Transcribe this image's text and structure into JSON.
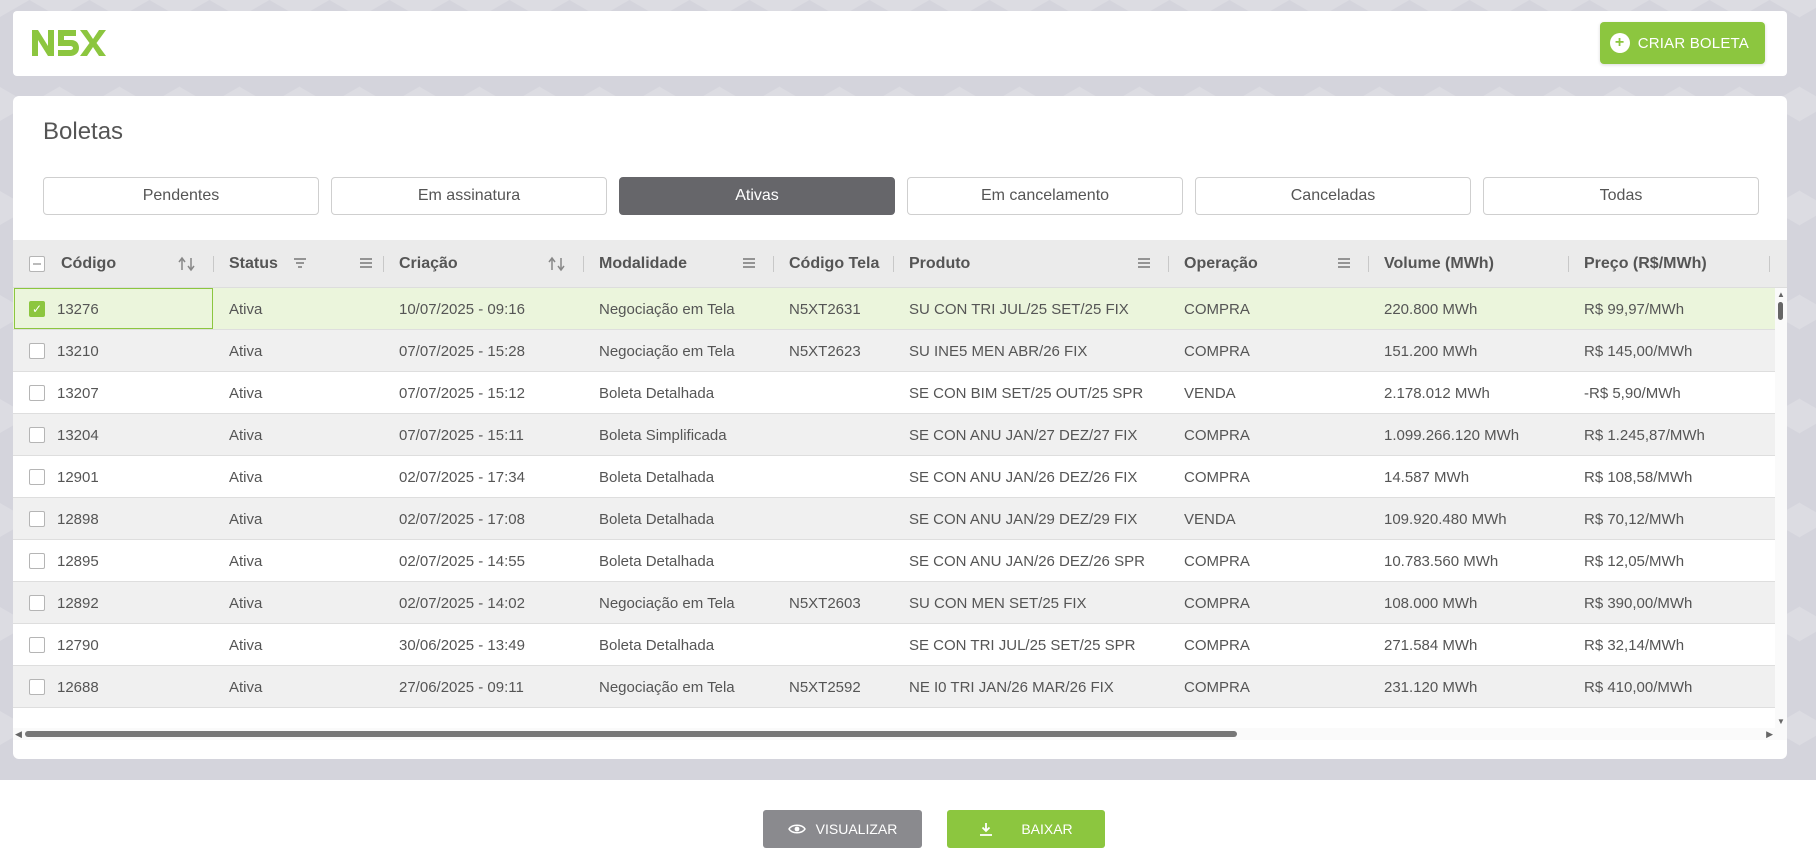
{
  "header": {
    "logo_text": "N5X",
    "create_button_label": "CRIAR BOLETA"
  },
  "page": {
    "title": "Boletas"
  },
  "tabs": [
    {
      "label": "Pendentes",
      "active": false
    },
    {
      "label": "Em assinatura",
      "active": false
    },
    {
      "label": "Ativas",
      "active": true
    },
    {
      "label": "Em cancelamento",
      "active": false
    },
    {
      "label": "Canceladas",
      "active": false
    },
    {
      "label": "Todas",
      "active": false
    }
  ],
  "table": {
    "columns": [
      "Código",
      "Status",
      "Criação",
      "Modalidade",
      "Código Tela",
      "Produto",
      "Operação",
      "Volume (MWh)",
      "Preço (R$/MWh)"
    ],
    "rows": [
      {
        "codigo": "13276",
        "status": "Ativa",
        "criacao": "10/07/2025 - 09:16",
        "modalidade": "Negociação em Tela",
        "codigo_tela": "N5XT2631",
        "produto": "SU CON TRI JUL/25 SET/25 FIX",
        "operacao": "COMPRA",
        "volume": "220.800 MWh",
        "preco": "R$ 99,97/MWh",
        "selected": true
      },
      {
        "codigo": "13210",
        "status": "Ativa",
        "criacao": "07/07/2025 - 15:28",
        "modalidade": "Negociação em Tela",
        "codigo_tela": "N5XT2623",
        "produto": "SU INE5 MEN ABR/26 FIX",
        "operacao": "COMPRA",
        "volume": "151.200 MWh",
        "preco": "R$ 145,00/MWh",
        "selected": false
      },
      {
        "codigo": "13207",
        "status": "Ativa",
        "criacao": "07/07/2025 - 15:12",
        "modalidade": "Boleta Detalhada",
        "codigo_tela": "",
        "produto": "SE CON BIM SET/25 OUT/25 SPR",
        "operacao": "VENDA",
        "volume": "2.178.012 MWh",
        "preco": "-R$ 5,90/MWh",
        "selected": false
      },
      {
        "codigo": "13204",
        "status": "Ativa",
        "criacao": "07/07/2025 - 15:11",
        "modalidade": "Boleta Simplificada",
        "codigo_tela": "",
        "produto": "SE CON ANU JAN/27 DEZ/27 FIX",
        "operacao": "COMPRA",
        "volume": "1.099.266.120 MWh",
        "preco": "R$ 1.245,87/MWh",
        "selected": false
      },
      {
        "codigo": "12901",
        "status": "Ativa",
        "criacao": "02/07/2025 - 17:34",
        "modalidade": "Boleta Detalhada",
        "codigo_tela": "",
        "produto": "SE CON ANU JAN/26 DEZ/26 FIX",
        "operacao": "COMPRA",
        "volume": "14.587 MWh",
        "preco": "R$ 108,58/MWh",
        "selected": false
      },
      {
        "codigo": "12898",
        "status": "Ativa",
        "criacao": "02/07/2025 - 17:08",
        "modalidade": "Boleta Detalhada",
        "codigo_tela": "",
        "produto": "SE CON ANU JAN/29 DEZ/29 FIX",
        "operacao": "VENDA",
        "volume": "109.920.480 MWh",
        "preco": "R$ 70,12/MWh",
        "selected": false
      },
      {
        "codigo": "12895",
        "status": "Ativa",
        "criacao": "02/07/2025 - 14:55",
        "modalidade": "Boleta Detalhada",
        "codigo_tela": "",
        "produto": "SE CON ANU JAN/26 DEZ/26 SPR",
        "operacao": "COMPRA",
        "volume": "10.783.560 MWh",
        "preco": "R$ 12,05/MWh",
        "selected": false
      },
      {
        "codigo": "12892",
        "status": "Ativa",
        "criacao": "02/07/2025 - 14:02",
        "modalidade": "Negociação em Tela",
        "codigo_tela": "N5XT2603",
        "produto": "SU CON MEN SET/25 FIX",
        "operacao": "COMPRA",
        "volume": "108.000 MWh",
        "preco": "R$ 390,00/MWh",
        "selected": false
      },
      {
        "codigo": "12790",
        "status": "Ativa",
        "criacao": "30/06/2025 - 13:49",
        "modalidade": "Boleta Detalhada",
        "codigo_tela": "",
        "produto": "SE CON TRI JUL/25 SET/25 SPR",
        "operacao": "COMPRA",
        "volume": "271.584 MWh",
        "preco": "R$ 32,14/MWh",
        "selected": false
      },
      {
        "codigo": "12688",
        "status": "Ativa",
        "criacao": "27/06/2025 - 09:11",
        "modalidade": "Negociação em Tela",
        "codigo_tela": "N5XT2592",
        "produto": "NE I0 TRI JAN/26 MAR/26 FIX",
        "operacao": "COMPRA",
        "volume": "231.120 MWh",
        "preco": "R$ 410,00/MWh",
        "selected": false
      }
    ]
  },
  "footer": {
    "view_label": "VISUALIZAR",
    "download_label": "BAIXAR"
  },
  "colors": {
    "brand_green": "#8cc63f",
    "active_tab": "#66666a",
    "view_button": "#8a8a8e"
  }
}
